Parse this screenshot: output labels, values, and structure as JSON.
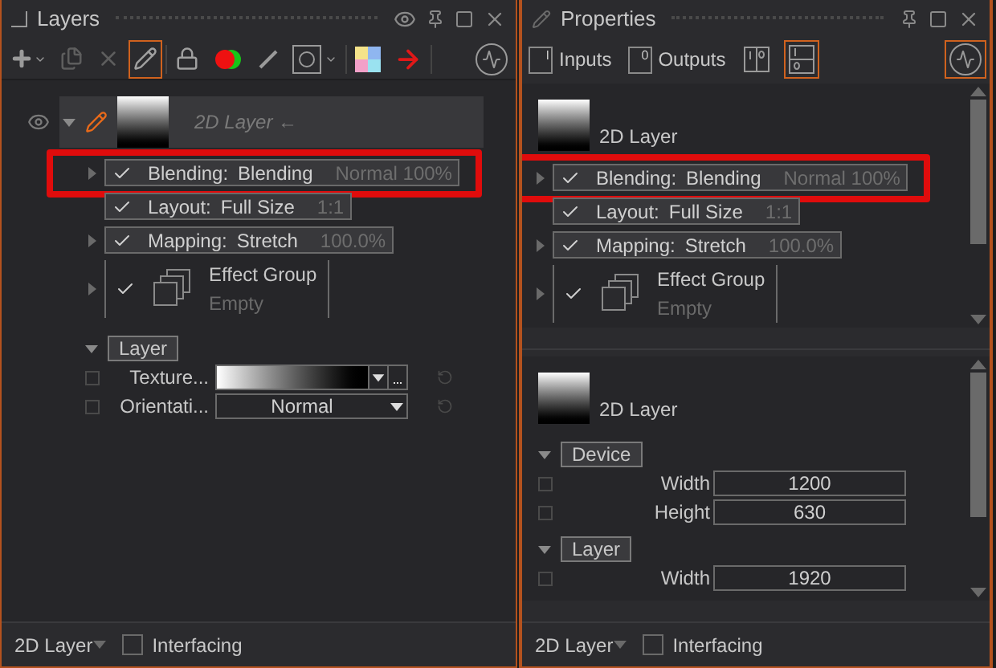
{
  "layers_panel": {
    "title": "Layers",
    "toolbar": [
      {
        "kind": "add",
        "selected": false
      },
      {
        "kind": "copy",
        "selected": false
      },
      {
        "kind": "delete",
        "selected": false
      },
      {
        "kind": "pencil",
        "selected": true
      },
      {
        "kind": "lock",
        "selected": false
      },
      {
        "kind": "dots",
        "selected": false
      },
      {
        "kind": "brush",
        "selected": false
      },
      {
        "kind": "shape",
        "selected": false
      },
      {
        "kind": "palette",
        "selected": false
      },
      {
        "kind": "arrow",
        "selected": false
      },
      {
        "kind": "pulse",
        "selected": false
      }
    ],
    "layer": {
      "name": "2D Layer ←",
      "expanded": true
    },
    "properties": [
      {
        "kind": "row",
        "label": "Blending:",
        "value": "Blending",
        "extra": "Normal 100%",
        "checked": true,
        "expandable": true,
        "highlighted": true
      },
      {
        "kind": "row",
        "label": "Layout:",
        "value": "Full Size",
        "extra": "1:1",
        "checked": true,
        "expandable": false,
        "highlighted": false
      },
      {
        "kind": "row",
        "label": "Mapping:",
        "value": "Stretch",
        "extra": "100.0%",
        "checked": true,
        "expandable": true,
        "highlighted": false
      },
      {
        "kind": "group",
        "label": "Effect Group",
        "value": "Empty",
        "checked": true,
        "expandable": true,
        "highlighted": false
      }
    ],
    "section": {
      "title": "Layer",
      "expanded": true
    },
    "fields": [
      {
        "kind": "texture",
        "label": "Texture...",
        "checked": false
      },
      {
        "kind": "select",
        "label": "Orientati...",
        "value": "Normal",
        "checked": false
      }
    ],
    "footer": {
      "type": "2D Layer",
      "interfacing": {
        "label": "Interfacing",
        "checked": false
      }
    }
  },
  "properties_panel": {
    "title": "Properties",
    "tabs": [
      {
        "label": "Inputs",
        "glyph": "I",
        "selected": false
      },
      {
        "label": "Outputs",
        "glyph": "0",
        "selected": false
      }
    ],
    "toolbar": [
      {
        "kind": "io",
        "selected": false
      },
      {
        "kind": "io-stack",
        "selected": true
      },
      {
        "kind": "pulse",
        "selected": true
      }
    ],
    "upper": {
      "name": "2D Layer",
      "properties": [
        {
          "kind": "row",
          "label": "Blending:",
          "value": "Blending",
          "extra": "Normal 100%",
          "checked": true,
          "expandable": true,
          "highlighted": true
        },
        {
          "kind": "row",
          "label": "Layout:",
          "value": "Full Size",
          "extra": "1:1",
          "checked": true,
          "expandable": false,
          "highlighted": false
        },
        {
          "kind": "row",
          "label": "Mapping:",
          "value": "Stretch",
          "extra": "100.0%",
          "checked": true,
          "expandable": true,
          "highlighted": false
        },
        {
          "kind": "group",
          "label": "Effect Group",
          "value": "Empty",
          "checked": true,
          "expandable": true,
          "highlighted": false
        }
      ]
    },
    "lower": {
      "name": "2D Layer",
      "sections": [
        {
          "title": "Device",
          "expanded": true,
          "fields": [
            {
              "label": "Width",
              "value": "1200",
              "checked": false
            },
            {
              "label": "Height",
              "value": "630",
              "checked": false
            }
          ]
        },
        {
          "title": "Layer",
          "expanded": true,
          "fields": [
            {
              "label": "Width",
              "value": "1920",
              "checked": false
            }
          ]
        }
      ]
    },
    "footer": {
      "type": "2D Layer",
      "interfacing": {
        "label": "Interfacing",
        "checked": false
      }
    }
  }
}
